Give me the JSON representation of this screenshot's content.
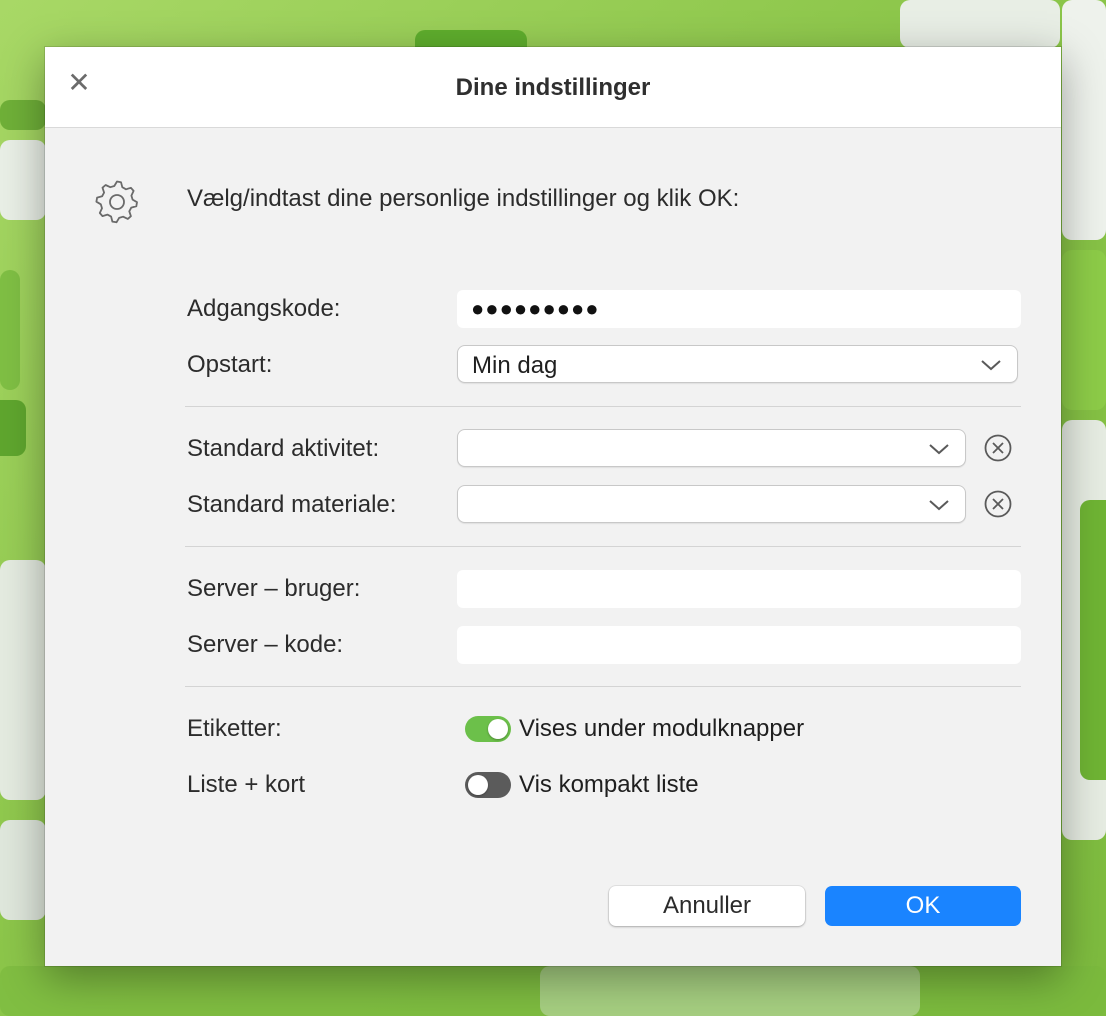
{
  "dialog": {
    "title": "Dine indstillinger",
    "intro": "Vælg/indtast dine personlige indstillinger og klik OK:"
  },
  "fields": {
    "password": {
      "label": "Adgangskode:",
      "value": "●●●●●●●●●"
    },
    "startup": {
      "label": "Opstart:",
      "value": "Min dag"
    },
    "default_activity": {
      "label": "Standard aktivitet:",
      "value": ""
    },
    "default_material": {
      "label": "Standard materiale:",
      "value": ""
    },
    "server_user": {
      "label": "Server – bruger:",
      "value": ""
    },
    "server_code": {
      "label": "Server – kode:",
      "value": ""
    }
  },
  "toggles": {
    "labels": {
      "label": "Etiketter:",
      "text": "Vises under modulknapper",
      "on": true
    },
    "list_card": {
      "label": "Liste + kort",
      "text": "Vis kompakt liste",
      "on": false
    }
  },
  "buttons": {
    "cancel": "Annuller",
    "ok": "OK"
  },
  "icons": {
    "close": "close-icon",
    "settings": "gear-icon",
    "dropdown": "chevron-down-icon",
    "clear": "clear-circle-icon"
  },
  "colors": {
    "accent": "#1a84ff",
    "toggle_on": "#6cc04a",
    "toggle_off": "#5b5b5b"
  }
}
